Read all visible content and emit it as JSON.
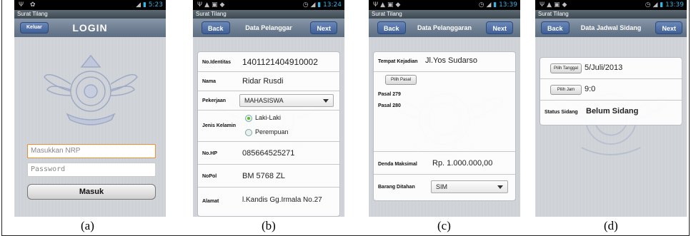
{
  "screens": [
    {
      "id": "a",
      "status_time": "5:23",
      "app_title": "Surat Tilang",
      "nav_left": "Keluar",
      "nav_title": "LOGIN",
      "nrp_placeholder": "Masukkan NRP",
      "password_placeholder": "Password",
      "submit_label": "Masuk",
      "caption": "(a)"
    },
    {
      "id": "b",
      "status_time": "13:24",
      "app_title": "Surat Tilang",
      "nav_left": "Back",
      "nav_title": "Data Pelanggar",
      "nav_right": "Next",
      "fields": [
        {
          "label": "No.Identitas",
          "value": "1401121404910002"
        },
        {
          "label": "Nama",
          "value": "Ridar Rusdi"
        },
        {
          "label": "Pekerjaan",
          "value": "MAHASISWA"
        },
        {
          "label": "Jenis Kelamin",
          "options": [
            "Laki-Laki",
            "Perempuan"
          ],
          "selected": "Laki-Laki"
        },
        {
          "label": "No.HP",
          "value": "085664525271"
        },
        {
          "label": "NoPol",
          "value": "BM 5768 ZL"
        },
        {
          "label": "Alamat",
          "value": "l.Kandis Gg.Irmala No.27"
        }
      ],
      "caption": "(b)"
    },
    {
      "id": "c",
      "status_time": "13:39",
      "app_title": "Surat Tilang",
      "nav_left": "Back",
      "nav_title": "Data Pelanggaran",
      "nav_right": "Next",
      "tempat_label": "Tempat Kejadian",
      "tempat_value": "Jl.Yos Sudarso",
      "pilih_pasal_label": "Pilih Pasal",
      "pasal_list": [
        "Pasal 279",
        "Pasal 280"
      ],
      "denda_label": "Denda Maksimal",
      "denda_value": "Rp. 1.000.000,00",
      "barang_label": "Barang Ditahan",
      "barang_value": "SIM",
      "caption": "(c)"
    },
    {
      "id": "d",
      "status_time": "13:39",
      "app_title": "Surat Tilang",
      "nav_left": "Back",
      "nav_title": "Data Jadwal Sidang",
      "nav_right": "Next",
      "pilih_tanggal_label": "Pilih Tanggal",
      "tanggal_value": "5/Juli/2013",
      "pilih_jam_label": "Pilih Jam",
      "jam_value": "9:0",
      "status_label": "Status Sidang",
      "status_value": "Belum Sidang",
      "caption": "(d)"
    }
  ],
  "colors": {
    "accent": "#35b5e5",
    "nav": "#5d6d82",
    "button": "#3f5f96",
    "focus": "#f28c28",
    "radio_on": "#4cbf2c"
  },
  "icons": [
    "usb-icon",
    "android-icon",
    "signal-icon",
    "battery-icon",
    "warning-icon",
    "image-icon",
    "cat-icon",
    "alarm-icon"
  ]
}
